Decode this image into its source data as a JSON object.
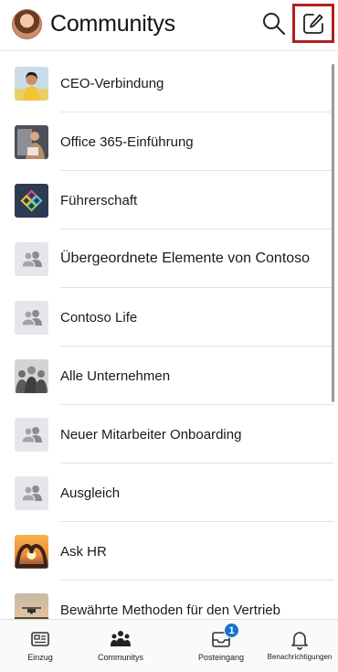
{
  "header": {
    "title": "Communitys",
    "avatar_icon": "user-avatar",
    "search_icon": "search-icon",
    "compose_icon": "compose-icon",
    "highlight_color": "#b01f1f"
  },
  "communities": [
    {
      "label": "CEO-Verbindung",
      "thumb": "ceo-photo"
    },
    {
      "label": "Office 365-Einführung",
      "thumb": "office-photo"
    },
    {
      "label": "Führerschaft",
      "thumb": "leadership-logo"
    },
    {
      "label": "Übergeordnete Elemente von Contoso",
      "thumb": "group-icon"
    },
    {
      "label": "Contoso Life",
      "thumb": "group-icon"
    },
    {
      "label": "Alle Unternehmen",
      "thumb": "people-photo"
    },
    {
      "label": "Neuer Mitarbeiter Onboarding",
      "thumb": "group-icon"
    },
    {
      "label": "Ausgleich",
      "thumb": "group-icon"
    },
    {
      "label": "Ask HR",
      "thumb": "sunset-heart-photo"
    },
    {
      "label": "Bewährte Methoden für den Vertrieb",
      "thumb": "drone-photo"
    }
  ],
  "tabbar": {
    "tabs": [
      {
        "label": "Einzug",
        "icon": "feed-icon"
      },
      {
        "label": "Communitys",
        "icon": "communities-icon"
      },
      {
        "label": "Posteingang",
        "icon": "inbox-icon",
        "badge": "1"
      },
      {
        "label": "Benachrichtigungen",
        "icon": "bell-icon"
      }
    ],
    "badge_color": "#1a73c9"
  }
}
